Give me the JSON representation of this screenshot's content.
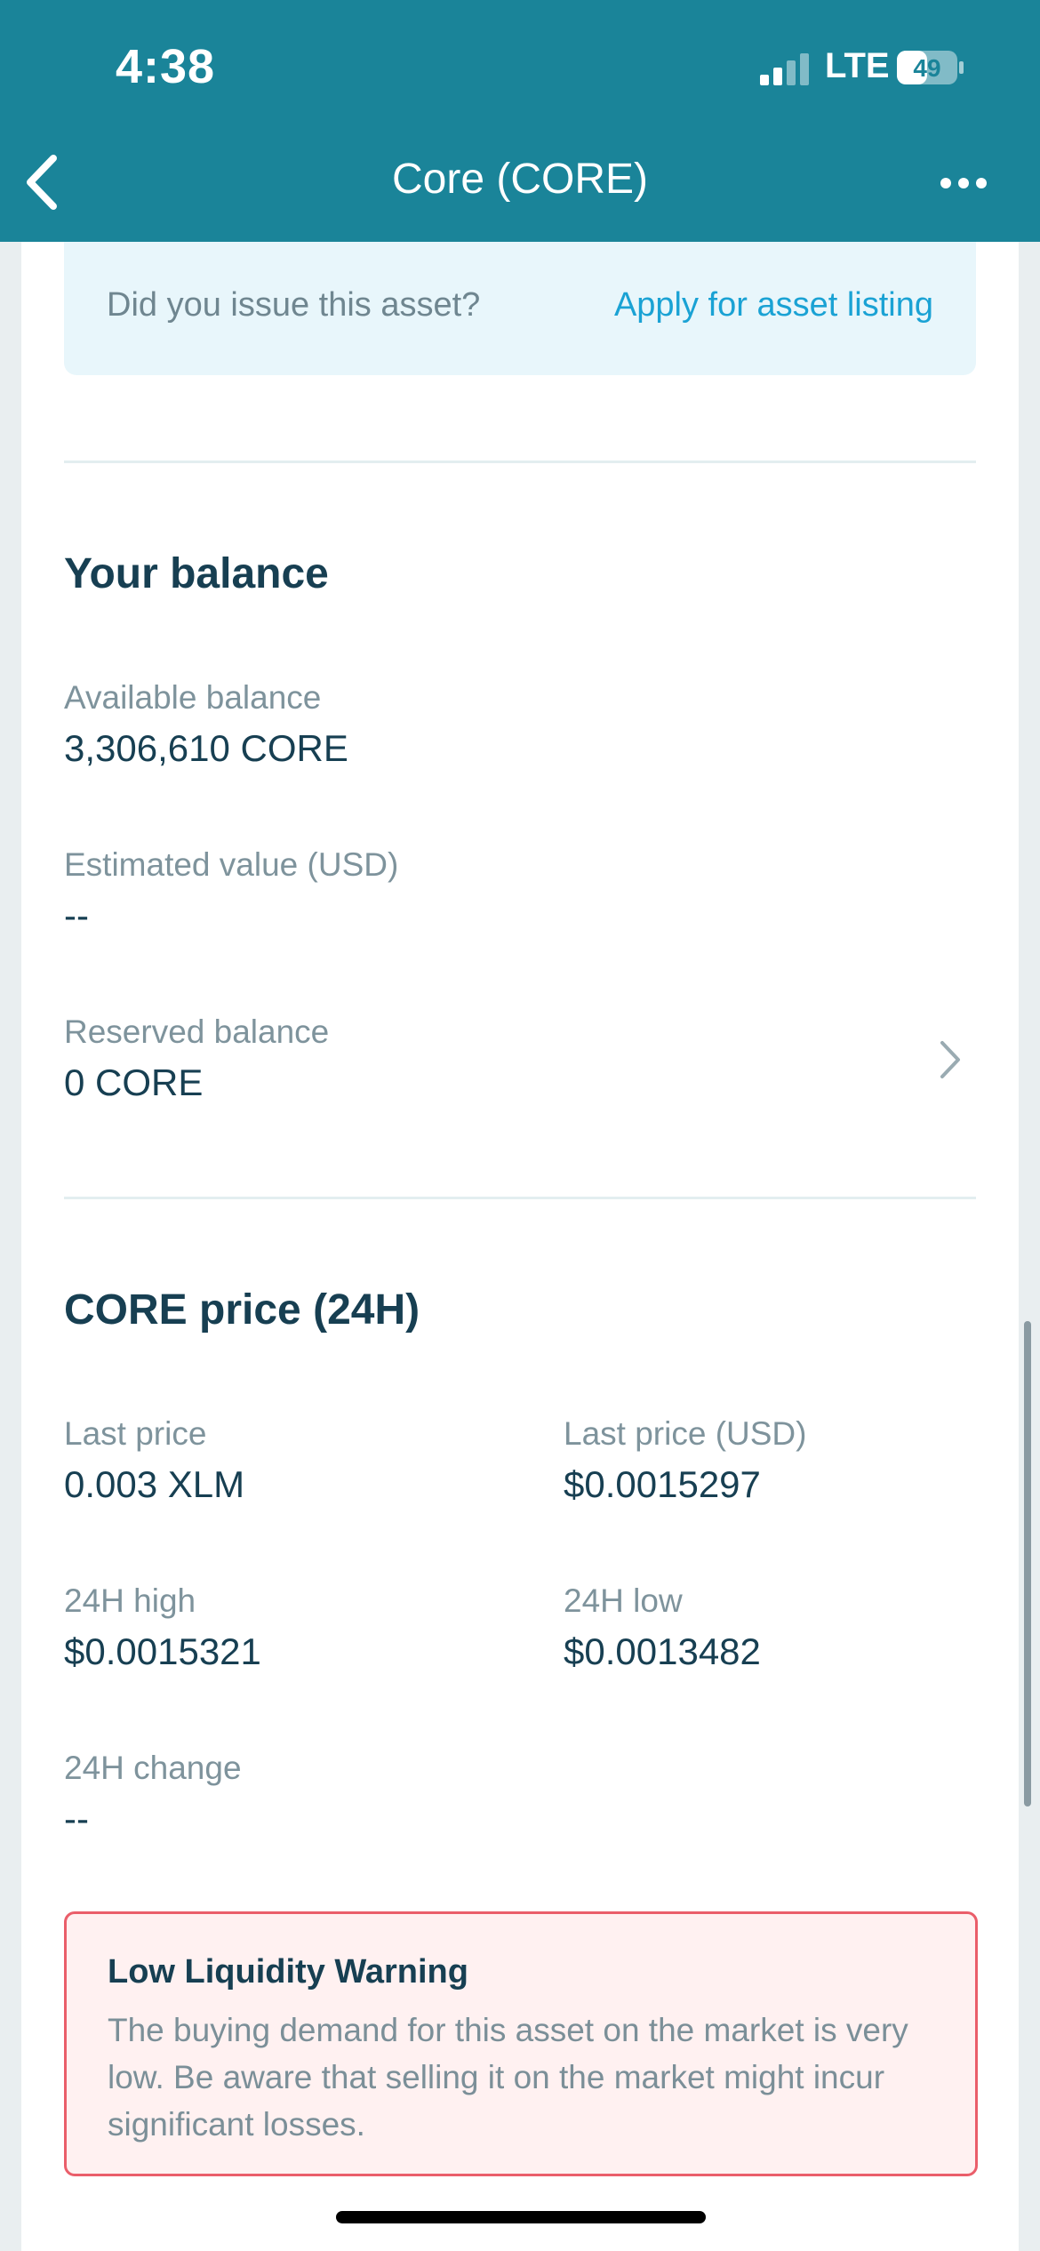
{
  "status_bar": {
    "time": "4:38",
    "network": "LTE",
    "battery": "49"
  },
  "nav": {
    "title": "Core (CORE)",
    "back_icon": "chevron-left-icon",
    "more_icon": "more-horizontal-icon"
  },
  "notice": {
    "question": "Did you issue this asset?",
    "link": "Apply for asset listing"
  },
  "balance": {
    "title": "Your balance",
    "available_label": "Available balance",
    "available_value": "3,306,610 CORE",
    "estimated_label": "Estimated value (USD)",
    "estimated_value": "--",
    "reserved_label": "Reserved balance",
    "reserved_value": "0 CORE"
  },
  "price": {
    "title": "CORE price (24H)",
    "last_price_label": "Last price",
    "last_price_value": "0.003 XLM",
    "last_price_usd_label": "Last price (USD)",
    "last_price_usd_value": "$0.0015297",
    "high_label": "24H high",
    "high_value": "$0.0015321",
    "low_label": "24H low",
    "low_value": "$0.0013482",
    "change_label": "24H change",
    "change_value": "--"
  },
  "warning": {
    "title": "Low Liquidity Warning",
    "body": "The buying demand for this asset on the market is very low. Be aware that selling it on the market might incur significant losses."
  },
  "colors": {
    "header": "#1a8499",
    "link": "#1aa2d4",
    "warning_border": "#ea5e6a",
    "warning_bg": "#fff1f1"
  }
}
